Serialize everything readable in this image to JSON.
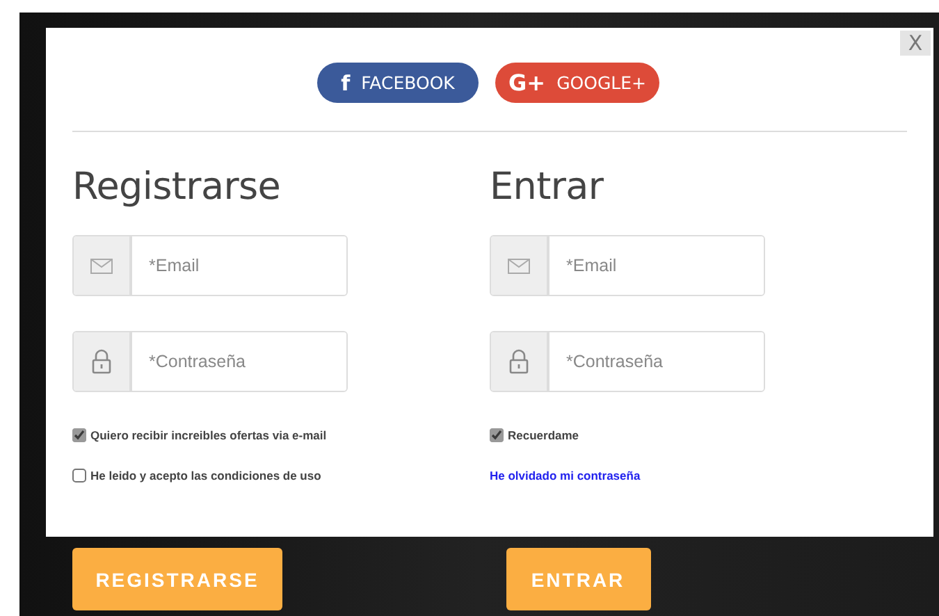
{
  "close_label": "X",
  "social_buttons": [
    {
      "kind": "facebook",
      "icon": "f",
      "label": "FACEBOOK"
    },
    {
      "kind": "google",
      "icon": "G+",
      "label": "GOOGLE+"
    }
  ],
  "forms": [
    {
      "title": "Registrarse",
      "fields": [
        {
          "kind": "email",
          "placeholder": "*Email"
        },
        {
          "kind": "password",
          "placeholder": "*Contraseña"
        }
      ],
      "options": [
        {
          "kind": "checkbox",
          "label": "Quiero recibir increibles ofertas via e-mail",
          "checked": true
        },
        {
          "kind": "checkbox",
          "label": "He leido y acepto las condiciones de uso",
          "checked": false
        }
      ],
      "submit": "REGISTRARSE"
    },
    {
      "title": "Entrar",
      "fields": [
        {
          "kind": "email",
          "placeholder": "*Email"
        },
        {
          "kind": "password",
          "placeholder": "*Contraseña"
        }
      ],
      "options": [
        {
          "kind": "checkbox",
          "label": "Recuerdame",
          "checked": true
        },
        {
          "kind": "link",
          "label": "He olvidado mi contraseña"
        }
      ],
      "submit": "ENTRAR"
    }
  ]
}
